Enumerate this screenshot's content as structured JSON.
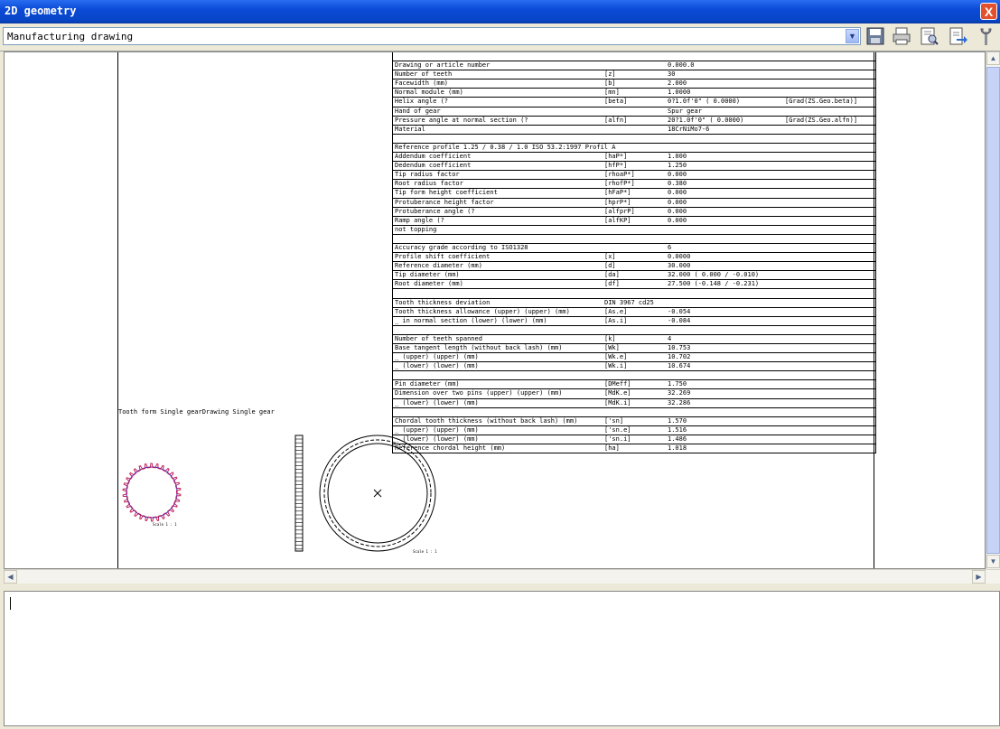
{
  "window": {
    "title": "2D geometry",
    "close_symbol": "X"
  },
  "toolbar": {
    "view_select_value": "Manufacturing drawing",
    "buttons": [
      {
        "name": "save-icon"
      },
      {
        "name": "print-icon"
      },
      {
        "name": "print-preview-icon"
      },
      {
        "name": "export-icon"
      },
      {
        "name": "settings-icon"
      }
    ]
  },
  "drawing": {
    "view_caption": "Tooth form Single gearDrawing Single gear",
    "scale_left": "Scale 1 : 1",
    "scale_right": "Scale 1 : 1",
    "data_rows": [
      {
        "label": "",
        "sym": "",
        "val": "",
        "ref": ""
      },
      {
        "label": "Drawing or article number",
        "sym": "",
        "val": "0.000.0",
        "ref": ""
      },
      {
        "label": "Number of teeth",
        "sym": "[z]",
        "val": "   30",
        "ref": ""
      },
      {
        "label": "Facewidth (mm)",
        "sym": "[b]",
        "val": "   2.000",
        "ref": ""
      },
      {
        "label": "Normal module (mm)",
        "sym": "[mn]",
        "val": "   1.0000",
        "ref": ""
      },
      {
        "label": "Helix angle (?",
        "sym": "[beta]",
        "val": "0?1.0f'0\" ( 0.0000)",
        "ref": "[Grad(ZS.Geo.beta)]"
      },
      {
        "label": "Hand of gear",
        "sym": "",
        "val": "Spur gear",
        "ref": ""
      },
      {
        "label": "Pressure angle at normal section (?",
        "sym": "[alfn]",
        "val": "20?1.0f'0\" ( 0.0000)",
        "ref": "[Grad(ZS.Geo.alfn)]"
      },
      {
        "label": "Material",
        "sym": "",
        "val": "18CrNiMo7-6",
        "ref": ""
      },
      {
        "label": "",
        "sym": "",
        "val": "",
        "ref": ""
      },
      {
        "label": "Reference profile       1.25 / 0.38 / 1.0 ISO 53.2:1997 Profil A",
        "sym": "",
        "val": "",
        "ref": ""
      },
      {
        "label": "Addendum coefficient",
        "sym": "[haP*]",
        "val": "1.000",
        "ref": ""
      },
      {
        "label": "Dedendum coefficient",
        "sym": "[hfP*]",
        "val": "1.250",
        "ref": ""
      },
      {
        "label": "Tip radius factor",
        "sym": "[rhoaP*]",
        "val": "0.000",
        "ref": ""
      },
      {
        "label": "Root radius factor",
        "sym": "[rhofP*]",
        "val": "0.380",
        "ref": ""
      },
      {
        "label": "Tip form height coefficient",
        "sym": "[hFaP*]",
        "val": "0.000",
        "ref": ""
      },
      {
        "label": "Protuberance height factor",
        "sym": "[hprP*]",
        "val": "0.000",
        "ref": ""
      },
      {
        "label": "Protuberance angle (?",
        "sym": "[alfprP]",
        "val": "0.000",
        "ref": ""
      },
      {
        "label": "Ramp angle (?",
        "sym": "[alfKP]",
        "val": "0.000",
        "ref": ""
      },
      {
        "label": "not topping",
        "sym": "",
        "val": "",
        "ref": ""
      },
      {
        "label": "",
        "sym": "",
        "val": "",
        "ref": ""
      },
      {
        "label": "Accuracy grade according to ISO1328",
        "sym": "",
        "val": "6",
        "ref": ""
      },
      {
        "label": "Profile shift coefficient",
        "sym": "[x]",
        "val": "0.0000",
        "ref": ""
      },
      {
        "label": "Reference diameter (mm)",
        "sym": "[d]",
        "val": "30.000",
        "ref": ""
      },
      {
        "label": "Tip diameter (mm)",
        "sym": "[da]",
        "val": "32.000 ( 0.000 / -0.010)",
        "ref": ""
      },
      {
        "label": "Root diameter (mm)",
        "sym": "[df]",
        "val": "27.500 (-0.148 / -0.231)",
        "ref": ""
      },
      {
        "label": "",
        "sym": "",
        "val": "",
        "ref": ""
      },
      {
        "label": "Tooth thickness deviation",
        "sym": "DIN 3967 cd25",
        "val": "",
        "ref": ""
      },
      {
        "label": "Tooth thickness allowance (upper) (upper) (mm)",
        "sym": "[As.e]",
        "val": "-0.054",
        "ref": ""
      },
      {
        "label": "_ in normal section (lower) (lower) (mm)",
        "sym": "[As.i]",
        "val": "-0.084",
        "ref": ""
      },
      {
        "label": "",
        "sym": "",
        "val": "",
        "ref": ""
      },
      {
        "label": "Number of teeth spanned",
        "sym": "[k]",
        "val": "4",
        "ref": ""
      },
      {
        "label": "Base tangent length (without back lash) (mm)",
        "sym": "[Wk]",
        "val": "10.753",
        "ref": ""
      },
      {
        "label": "_ (upper) (upper) (mm)",
        "sym": "[Wk.e]",
        "val": "10.702",
        "ref": ""
      },
      {
        "label": "_ (lower) (lower) (mm)",
        "sym": "[Wk.i]",
        "val": "10.674",
        "ref": ""
      },
      {
        "label": "",
        "sym": "",
        "val": "",
        "ref": ""
      },
      {
        "label": "Pin diameter (mm)",
        "sym": "[DMeff]",
        "val": "1.750",
        "ref": ""
      },
      {
        "label": "Dimension over two pins (upper) (upper) (mm)",
        "sym": "[MdK.e]",
        "val": "32.269",
        "ref": ""
      },
      {
        "label": "_ (lower) (lower) (mm)",
        "sym": "[MdK.i]",
        "val": "32.286",
        "ref": ""
      },
      {
        "label": "",
        "sym": "",
        "val": "",
        "ref": ""
      },
      {
        "label": "Chordal tooth thickness (without back lash) (mm)",
        "sym": "['sn]",
        "val": "1.570",
        "ref": ""
      },
      {
        "label": "_ (upper) (upper) (mm)",
        "sym": "['sn.e]",
        "val": "1.516",
        "ref": ""
      },
      {
        "label": "_ (lower) (lower) (mm)",
        "sym": "['sn.i]",
        "val": "1.486",
        "ref": ""
      },
      {
        "label": "Reference chordal height (mm)",
        "sym": "[ha]",
        "val": "1.018",
        "ref": ""
      }
    ]
  },
  "text_pane": {
    "content": ""
  }
}
